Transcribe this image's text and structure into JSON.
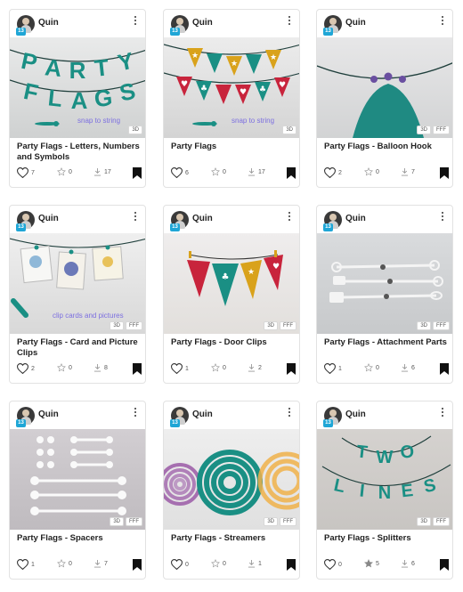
{
  "colors": {
    "teal": "#1a8f84",
    "mustard": "#d9a21b",
    "crimson": "#c8243c",
    "caption": "#7c6fe0",
    "level_badge": "#1fa6d6"
  },
  "cards": [
    {
      "author": "Quin",
      "level": "13",
      "title": "Party Flags - Letters, Numbers and Symbols",
      "badges": [
        "3D"
      ],
      "caption": "snap to string",
      "likes": "7",
      "stars": "0",
      "downloads": "17",
      "starred": false,
      "image": "party-flags-letters"
    },
    {
      "author": "Quin",
      "level": "13",
      "title": "Party Flags",
      "badges": [
        "3D"
      ],
      "caption": "snap to string",
      "likes": "6",
      "stars": "0",
      "downloads": "17",
      "starred": false,
      "image": "party-flags-pennants"
    },
    {
      "author": "Quin",
      "level": "13",
      "title": "Party Flags - Balloon Hook",
      "badges": [
        "3D",
        "FFF"
      ],
      "caption": "",
      "likes": "2",
      "stars": "0",
      "downloads": "7",
      "starred": false,
      "image": "balloon-hook"
    },
    {
      "author": "Quin",
      "level": "13",
      "title": "Party Flags - Card and Picture Clips",
      "badges": [
        "3D",
        "FFF"
      ],
      "caption": "clip cards and pictures",
      "likes": "2",
      "stars": "0",
      "downloads": "8",
      "starred": false,
      "image": "card-clips"
    },
    {
      "author": "Quin",
      "level": "13",
      "title": "Party Flags - Door Clips",
      "badges": [
        "3D",
        "FFF"
      ],
      "caption": "",
      "likes": "1",
      "stars": "0",
      "downloads": "2",
      "starred": false,
      "image": "door-clips"
    },
    {
      "author": "Quin",
      "level": "13",
      "title": "Party Flags - Attachment Parts",
      "badges": [
        "3D",
        "FFF"
      ],
      "caption": "",
      "likes": "1",
      "stars": "0",
      "downloads": "6",
      "starred": false,
      "image": "attachment-parts"
    },
    {
      "author": "Quin",
      "level": "13",
      "title": "Party Flags - Spacers",
      "badges": [
        "3D",
        "FFF"
      ],
      "caption": "",
      "likes": "1",
      "stars": "0",
      "downloads": "7",
      "starred": false,
      "image": "spacers"
    },
    {
      "author": "Quin",
      "level": "13",
      "title": "Party Flags - Streamers",
      "badges": [
        "3D",
        "FFF"
      ],
      "caption": "",
      "likes": "0",
      "stars": "0",
      "downloads": "1",
      "starred": false,
      "image": "streamers"
    },
    {
      "author": "Quin",
      "level": "13",
      "title": "Party Flags - Splitters",
      "badges": [
        "3D",
        "FFF"
      ],
      "caption": "",
      "likes": "0",
      "stars": "5",
      "downloads": "6",
      "starred": true,
      "image": "splitters"
    }
  ],
  "image_text": {
    "party": [
      "P",
      "A",
      "R",
      "T",
      "Y"
    ],
    "flags": [
      "F",
      "L",
      "A",
      "G",
      "S"
    ],
    "two": [
      "T",
      "W",
      "O"
    ],
    "lines": [
      "L",
      "I",
      "N",
      "E",
      "S"
    ]
  },
  "icons": {
    "more": "more-vertical-icon",
    "like": "heart-outline-icon",
    "star": "star-icon",
    "download": "download-icon",
    "bookmark": "bookmark-icon"
  }
}
